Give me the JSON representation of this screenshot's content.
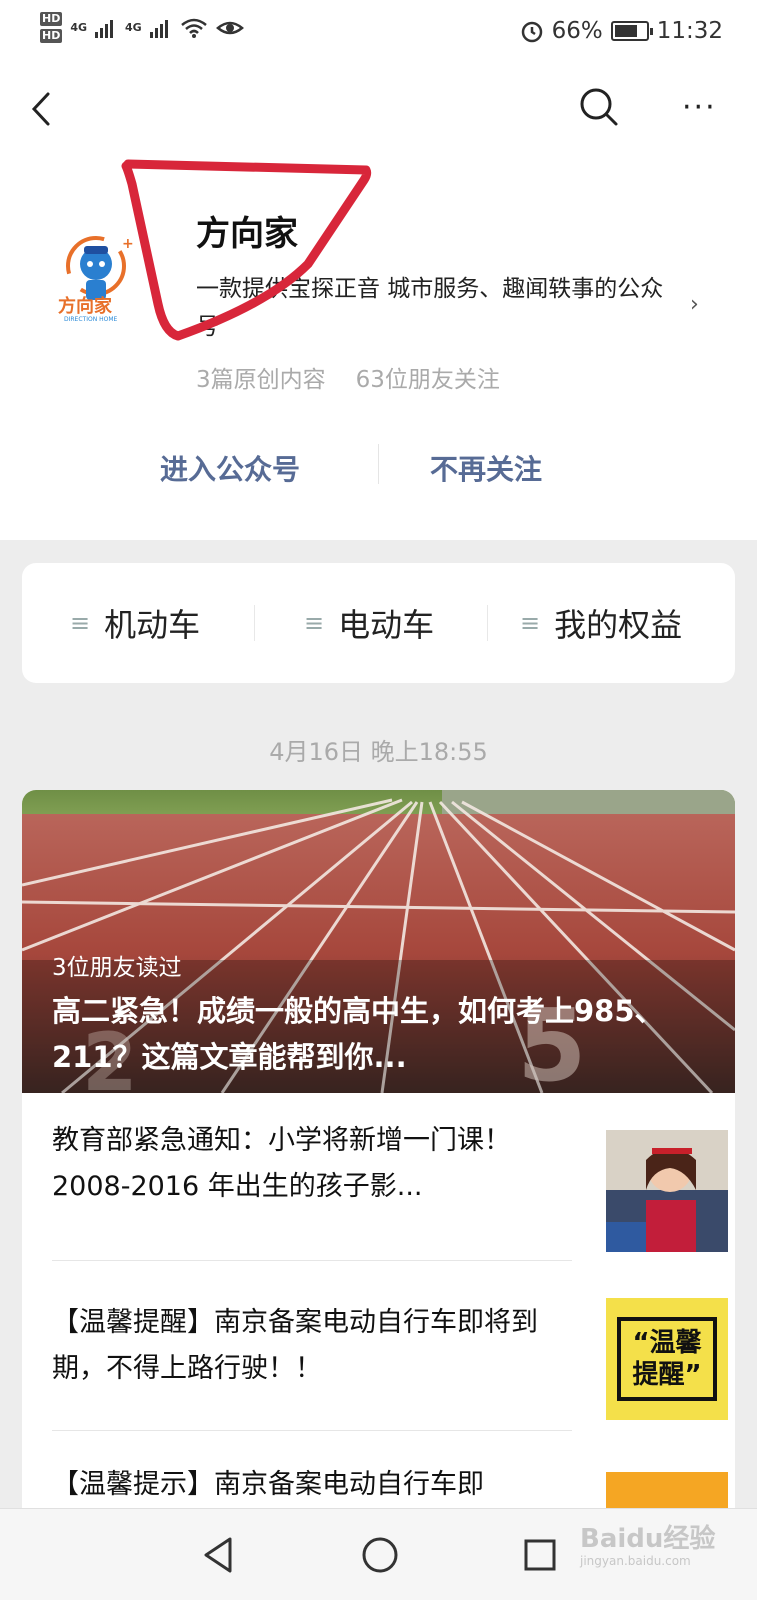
{
  "status_bar": {
    "hd1": "HD",
    "hd2": "HD",
    "signal1": "4G",
    "signal2": "4G",
    "battery": "66%",
    "time": "11:32"
  },
  "nav": {
    "more": "···"
  },
  "account": {
    "logo_text": "方向家",
    "logo_subtext": "DIRECTION HOME",
    "name": "方向家",
    "description": "一款提供宝探正音 城市服务、趣闻轶事的公众号",
    "stat_original": "3篇原创内容",
    "stat_friends": "63位朋友关注",
    "enter_button": "进入公众号",
    "unfollow_button": "不再关注"
  },
  "menu": {
    "items": [
      {
        "label": "机动车",
        "icon": "menu-lines-icon"
      },
      {
        "label": "电动车",
        "icon": "menu-lines-icon"
      },
      {
        "label": "我的权益",
        "icon": "menu-lines-icon"
      }
    ]
  },
  "feed": {
    "datetime": "4月16日 晚上18:55",
    "hero": {
      "friends_read": "3位朋友读过",
      "title": "高二紧急！成绩一般的高中生，如何考上985、211？这篇文章能帮到你..."
    },
    "articles": [
      {
        "title": "教育部紧急通知：小学将新增一门课！2008-2016 年出生的孩子影..."
      },
      {
        "title": "【温馨提醒】南京备案电动自行车即将到期，不得上路行驶！！",
        "thumb_text_1": "“温馨",
        "thumb_text_2": "提醒”"
      },
      {
        "title": "【温馨提示】南京备案电动自行车即"
      }
    ]
  },
  "watermark": {
    "text": "Baidu经验",
    "sub": "jingyan.baidu.com"
  },
  "colors": {
    "link_blue": "#576b95",
    "annotation_red": "#d8263a",
    "track_red": "#b34a3c"
  }
}
